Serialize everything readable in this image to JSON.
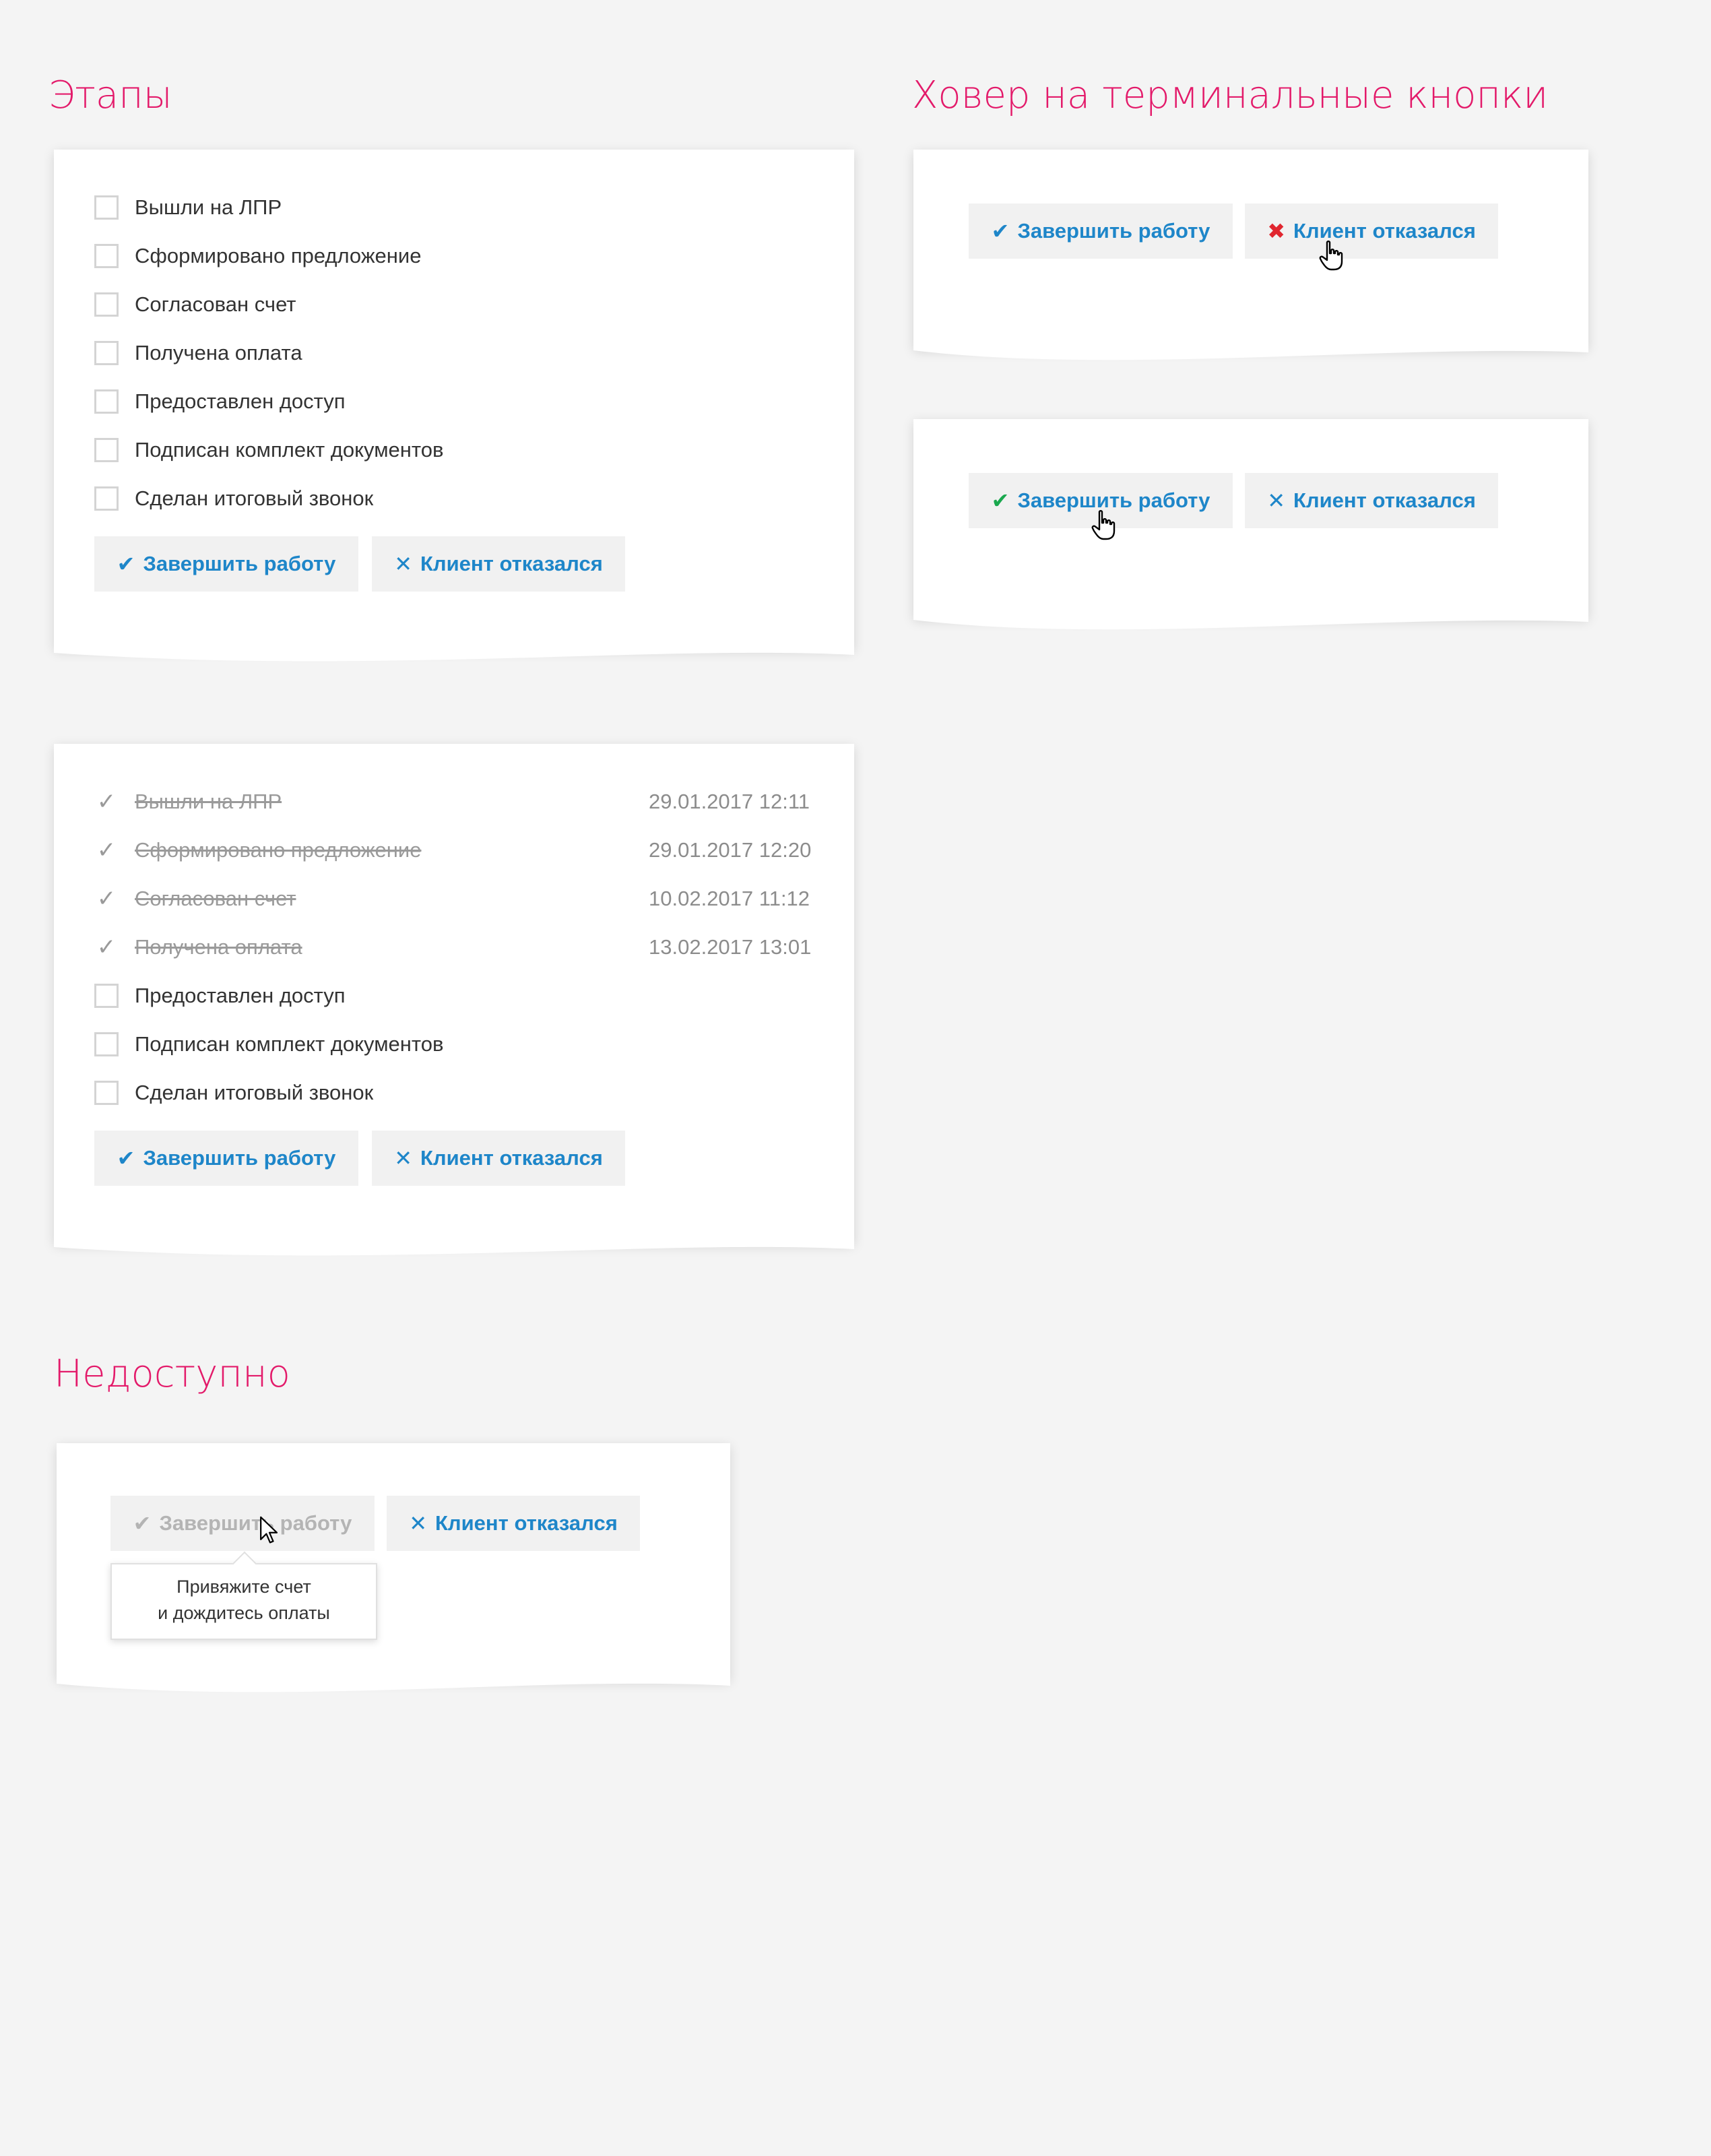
{
  "sections": {
    "stages_title": "Этапы",
    "hover_title": "Ховер на терминальные кнопки",
    "unavailable_title": "Недоступно"
  },
  "buttons": {
    "finish_label": "Завершить работу",
    "refused_label": "Клиент отказался",
    "check_icon": "✔",
    "cross_icon": "✕",
    "cross_bold_icon": "✖"
  },
  "colors": {
    "accent_pink": "#e31a6a",
    "link_blue": "#1e86c9",
    "success_green": "#1aa84e",
    "danger_red": "#e0262f",
    "disabled_gray": "#b4b4b4"
  },
  "stages_card": {
    "steps": [
      {
        "label": "Вышли на ЛПР"
      },
      {
        "label": "Сформировано предложение"
      },
      {
        "label": "Согласован счет"
      },
      {
        "label": "Получена оплата"
      },
      {
        "label": "Предоставлен доступ"
      },
      {
        "label": "Подписан комплект документов"
      },
      {
        "label": "Сделан итоговый звонок"
      }
    ]
  },
  "progress_card": {
    "steps": [
      {
        "label": "Вышли на ЛПР",
        "done": true,
        "date": "29.01.2017   12:11"
      },
      {
        "label": "Сформировано предложение",
        "done": true,
        "date": "29.01.2017   12:20"
      },
      {
        "label": "Согласован счет",
        "done": true,
        "date": "10.02.2017   11:12"
      },
      {
        "label": "Получена оплата",
        "done": true,
        "date": "13.02.2017   13:01"
      },
      {
        "label": "Предоставлен доступ",
        "done": false
      },
      {
        "label": "Подписан комплект документов",
        "done": false
      },
      {
        "label": "Сделан итоговый звонок",
        "done": false
      }
    ]
  },
  "tooltip": {
    "line1": "Привяжите счет",
    "line2": "и дождитесь оплаты"
  }
}
